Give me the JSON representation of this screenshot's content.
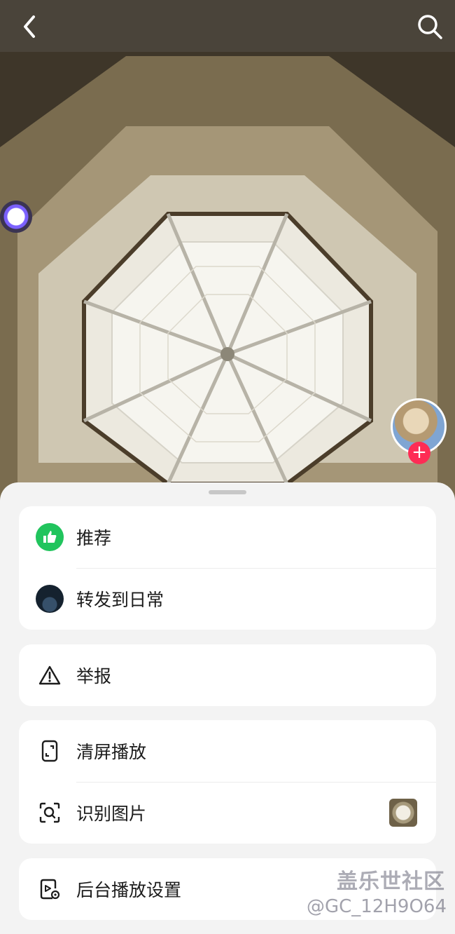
{
  "header": {
    "back_icon": "chevron-left-icon",
    "search_icon": "search-icon"
  },
  "menu": {
    "group1": [
      {
        "label": "推荐",
        "icon": "thumbs-up-icon",
        "color": "#21c45d"
      },
      {
        "label": "转发到日常",
        "icon": "moment-avatar-icon"
      }
    ],
    "group2": [
      {
        "label": "举报",
        "icon": "warning-icon"
      }
    ],
    "group3": [
      {
        "label": "清屏播放",
        "icon": "clear-screen-icon"
      },
      {
        "label": "识别图片",
        "icon": "scan-image-icon"
      }
    ],
    "group4": [
      {
        "label": "后台播放设置",
        "icon": "background-play-icon"
      }
    ]
  },
  "watermark": {
    "site": "盖乐世社区",
    "user": "@GC_12H9O64"
  },
  "colors": {
    "follow_accent": "#fe2c55",
    "like_green": "#21c45d",
    "sheet_bg": "#f3f3f3"
  }
}
